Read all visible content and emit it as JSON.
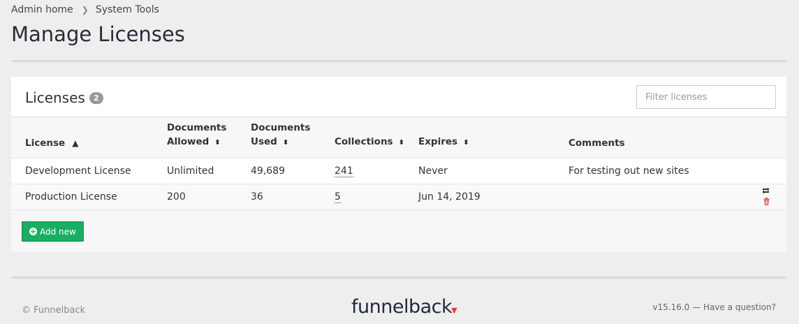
{
  "breadcrumb": {
    "home": "Admin home",
    "current": "System Tools"
  },
  "page": {
    "title": "Manage Licenses"
  },
  "panel": {
    "title": "Licenses",
    "count": "2",
    "filter_placeholder": "Filter licenses",
    "add_label": "Add new"
  },
  "table": {
    "headers": {
      "license": "License",
      "docs_allowed_1": "Documents",
      "docs_allowed_2": "Allowed",
      "docs_used_1": "Documents",
      "docs_used_2": "Used",
      "collections": "Collections",
      "expires": "Expires",
      "comments": "Comments"
    },
    "rows": [
      {
        "license": "Development License",
        "allowed": "Unlimited",
        "used": "49,689",
        "collections": "241",
        "expires": "Never",
        "comments": "For testing out new sites"
      },
      {
        "license": "Production License",
        "allowed": "200",
        "used": "36",
        "collections": "5",
        "expires": "Jun 14, 2019",
        "comments": ""
      }
    ]
  },
  "footer": {
    "copyright": "© Funnelback",
    "logo": "funnelback",
    "version": "v15.16.0 — Have a question?"
  },
  "colors": {
    "accent": "#1aae62",
    "danger": "#d9534f",
    "logo_mark": "#e33b2e"
  },
  "icons": [
    "chevron-right-icon",
    "sort-asc-icon",
    "sort-icon",
    "renew-icon",
    "trash-icon",
    "plus-circle-icon"
  ]
}
